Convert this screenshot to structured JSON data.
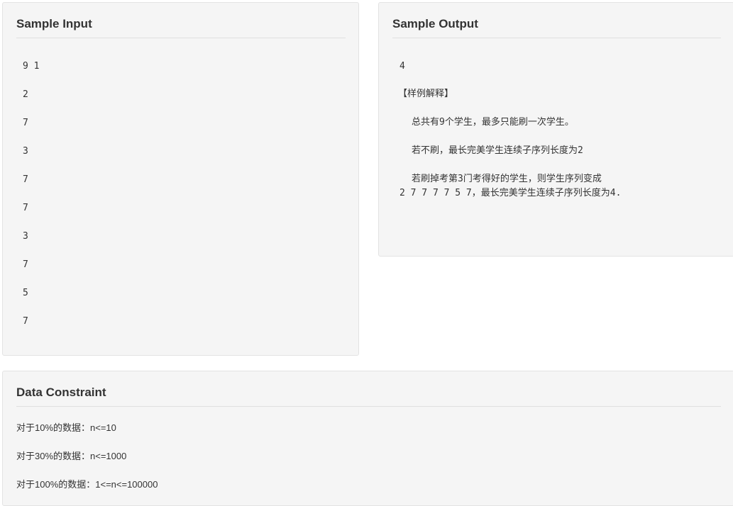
{
  "sample_input": {
    "title": "Sample Input",
    "lines": [
      "9 1",
      "2",
      "7",
      "3",
      "7",
      "7",
      "3",
      "7",
      "5",
      "7"
    ]
  },
  "sample_output": {
    "title": "Sample Output",
    "answer": "4",
    "explanation_header": "【样例解释】",
    "explanation_lines": [
      "总共有9个学生，最多只能刷一次学生。",
      "若不刷，最长完美学生连续子序列长度为2",
      "若刷掉考第3门考得好的学生，则学生序列变成",
      "2 7 7 7 7 5 7，最长完美学生连续子序列长度为4."
    ]
  },
  "data_constraint": {
    "title": "Data Constraint",
    "lines": [
      "对于10%的数据：n<=10",
      "对于30%的数据：n<=1000",
      "对于100%的数据：1<=n<=100000"
    ]
  }
}
